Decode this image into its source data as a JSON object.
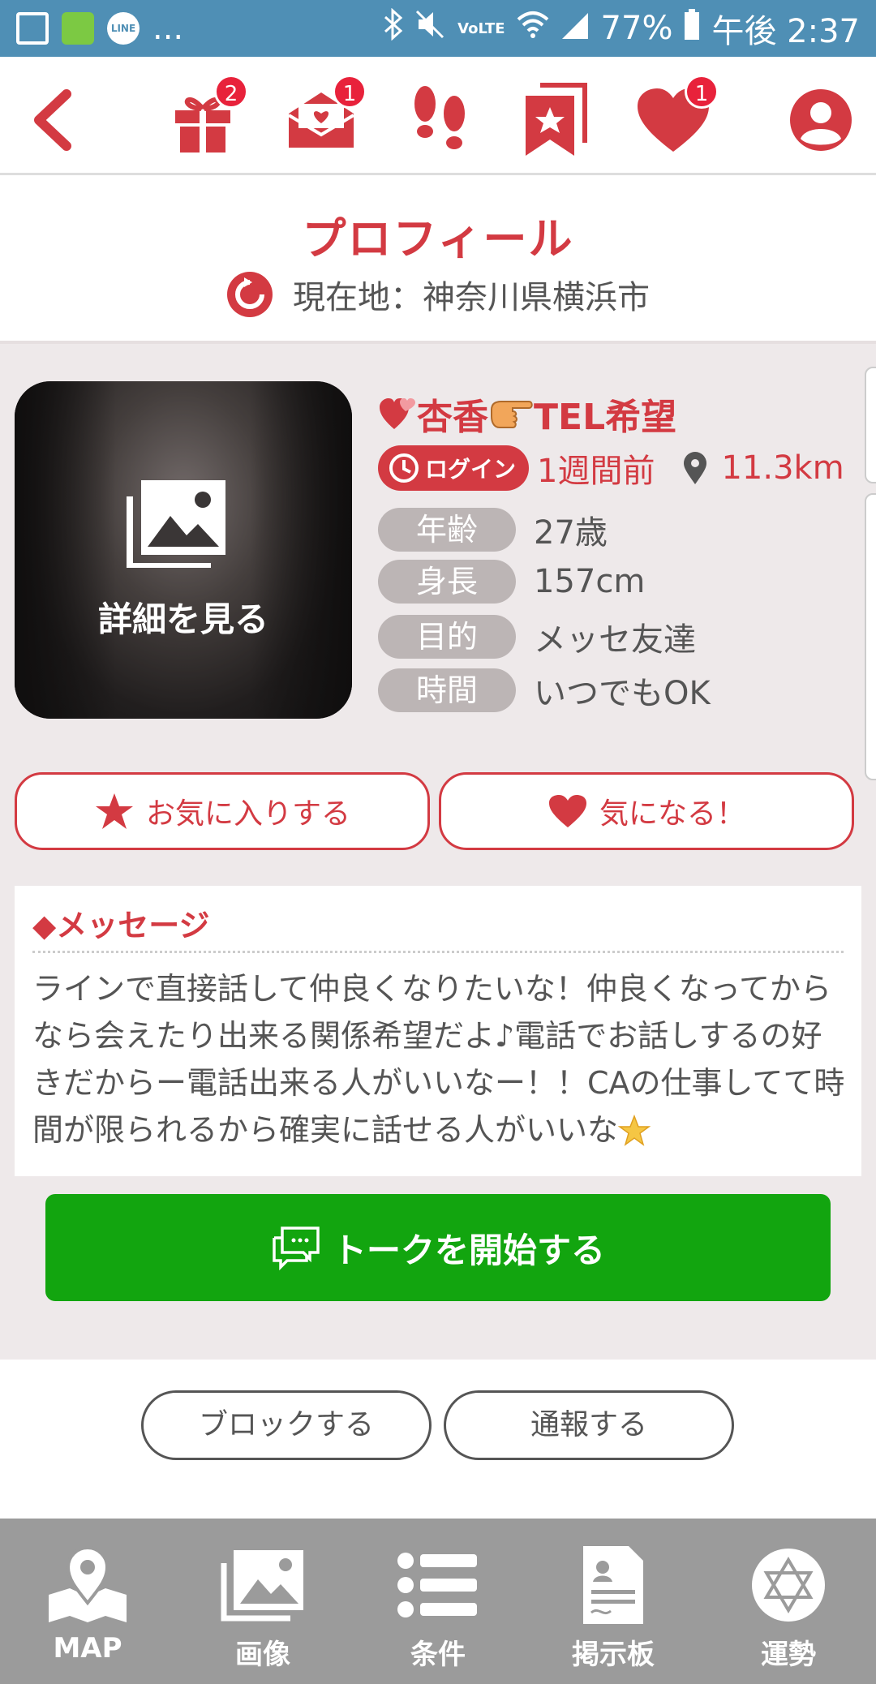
{
  "status_bar": {
    "dots": "...",
    "line_label": "LINE",
    "lte_label": "VoLTE",
    "battery": "77%",
    "time": "午後 2:37"
  },
  "top_nav": {
    "gift_badge": "2",
    "mail_badge": "1",
    "like_badge": "1"
  },
  "header": {
    "title": "プロフィール",
    "location": "現在地：神奈川県横浜市"
  },
  "photo": {
    "detail_label": "詳細を見る"
  },
  "profile": {
    "name": "杏香",
    "name_suffix": "TEL希望",
    "login_label": "ログイン",
    "last_login": "1週間前",
    "distance": "11.3km",
    "info": [
      {
        "label": "年齢",
        "value": "27歳"
      },
      {
        "label": "身長",
        "value": "157cm"
      },
      {
        "label": "目的",
        "value": "メッセ友達"
      },
      {
        "label": "時間",
        "value": "いつでもOK"
      }
    ]
  },
  "actions": {
    "favorite": "お気に入りする",
    "interested": "気になる！"
  },
  "message": {
    "title": "◆メッセージ",
    "body": "ラインで直接話して仲良くなりたいな！仲良くなってからなら会えたり出来る関係希望だよ♪電話でお話しするの好きだからー電話出来る人がいいなー！！CAの仕事してて時間が限られるから確実に話せる人がいいな"
  },
  "talk_button": "トークを開始する",
  "block_button": "ブロックする",
  "report_button": "通報する",
  "bottom_nav": [
    {
      "label": "MAP",
      "icon": "map-pin-icon"
    },
    {
      "label": "画像",
      "icon": "image-icon"
    },
    {
      "label": "条件",
      "icon": "list-icon"
    },
    {
      "label": "掲示板",
      "icon": "board-icon"
    },
    {
      "label": "運勢",
      "icon": "star-of-david-icon"
    }
  ],
  "colors": {
    "accent": "#d33a42",
    "talk_green": "#12a50f",
    "status_bar": "#4f8fb5",
    "bottom_nav": "#9b9b9b"
  }
}
